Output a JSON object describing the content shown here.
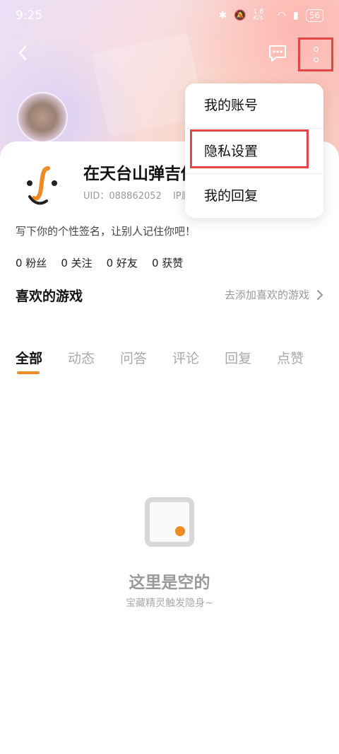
{
  "status_bar": {
    "time": "9:25",
    "network_speed": "1.8 K/s",
    "battery": "56"
  },
  "header": {
    "back_icon": "chevron-left-icon",
    "message_icon": "message-icon",
    "more_icon": "more-vertical-icon"
  },
  "profile": {
    "username": "在天台山弹吉他",
    "uid": "UID：088862052",
    "ip": "IP属地：",
    "signature": "写下你的个性签名，让别人记住你吧！",
    "stats": {
      "fans": "0 粉丝",
      "following": "0 关注",
      "friends": "0 好友",
      "likes": "0 获赞"
    }
  },
  "favorite_games": {
    "title": "喜欢的游戏",
    "add_label": "去添加喜欢的游戏"
  },
  "tabs": [
    {
      "label": "全部"
    },
    {
      "label": "动态"
    },
    {
      "label": "问答"
    },
    {
      "label": "评论"
    },
    {
      "label": "回复"
    },
    {
      "label": "点赞"
    }
  ],
  "empty_state": {
    "title": "这里是空的",
    "subtitle": "宝藏精灵触发隐身~"
  },
  "popup_menu": {
    "items": [
      "我的账号",
      "隐私设置",
      "我的回复"
    ]
  },
  "colors": {
    "accent": "#f08a24",
    "highlight": "#e64545"
  }
}
